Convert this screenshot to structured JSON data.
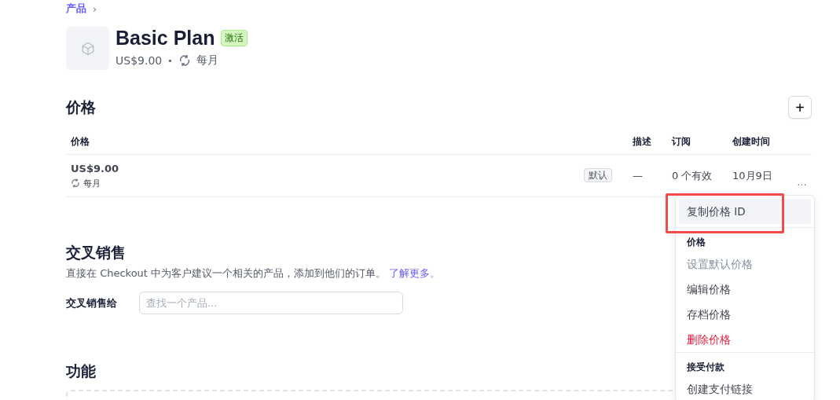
{
  "breadcrumb": {
    "link": "产品",
    "separator": "›"
  },
  "product": {
    "name": "Basic Plan",
    "status": "激活",
    "price": "US$9.00",
    "separator": "•",
    "interval": "每月"
  },
  "prices": {
    "title": "价格",
    "add_button": "+",
    "columns": [
      "价格",
      "描述",
      "订阅",
      "创建时间"
    ],
    "rows": [
      {
        "amount": "US$9.00",
        "interval": "每月",
        "badge": "默认",
        "description": "—",
        "subscriptions": "0 个有效",
        "created": "10月9日",
        "menu_button": "…"
      }
    ]
  },
  "menu": {
    "highlighted_frame": true,
    "items": [
      {
        "kind": "action",
        "label": "复制价格 ID",
        "highlighted": true,
        "disabled": false,
        "danger": false
      },
      {
        "kind": "heading",
        "label": "价格"
      },
      {
        "kind": "action",
        "label": "设置默认价格",
        "highlighted": false,
        "disabled": true,
        "danger": false
      },
      {
        "kind": "action",
        "label": "编辑价格",
        "highlighted": false,
        "disabled": false,
        "danger": false
      },
      {
        "kind": "action",
        "label": "存档价格",
        "highlighted": false,
        "disabled": false,
        "danger": false
      },
      {
        "kind": "action",
        "label": "删除价格",
        "highlighted": false,
        "disabled": false,
        "danger": true
      },
      {
        "kind": "heading",
        "label": "接受付款"
      },
      {
        "kind": "action",
        "label": "创建支付链接",
        "highlighted": false,
        "disabled": false,
        "danger": false
      }
    ]
  },
  "cross_sell": {
    "title": "交叉销售",
    "description": "直接在 Checkout 中为客户建议一个相关的产品，添加到他们的订单。",
    "link": "了解更多。",
    "field_label": "交叉销售给",
    "placeholder": "查找一个产品..."
  },
  "features": {
    "title": "功能"
  }
}
